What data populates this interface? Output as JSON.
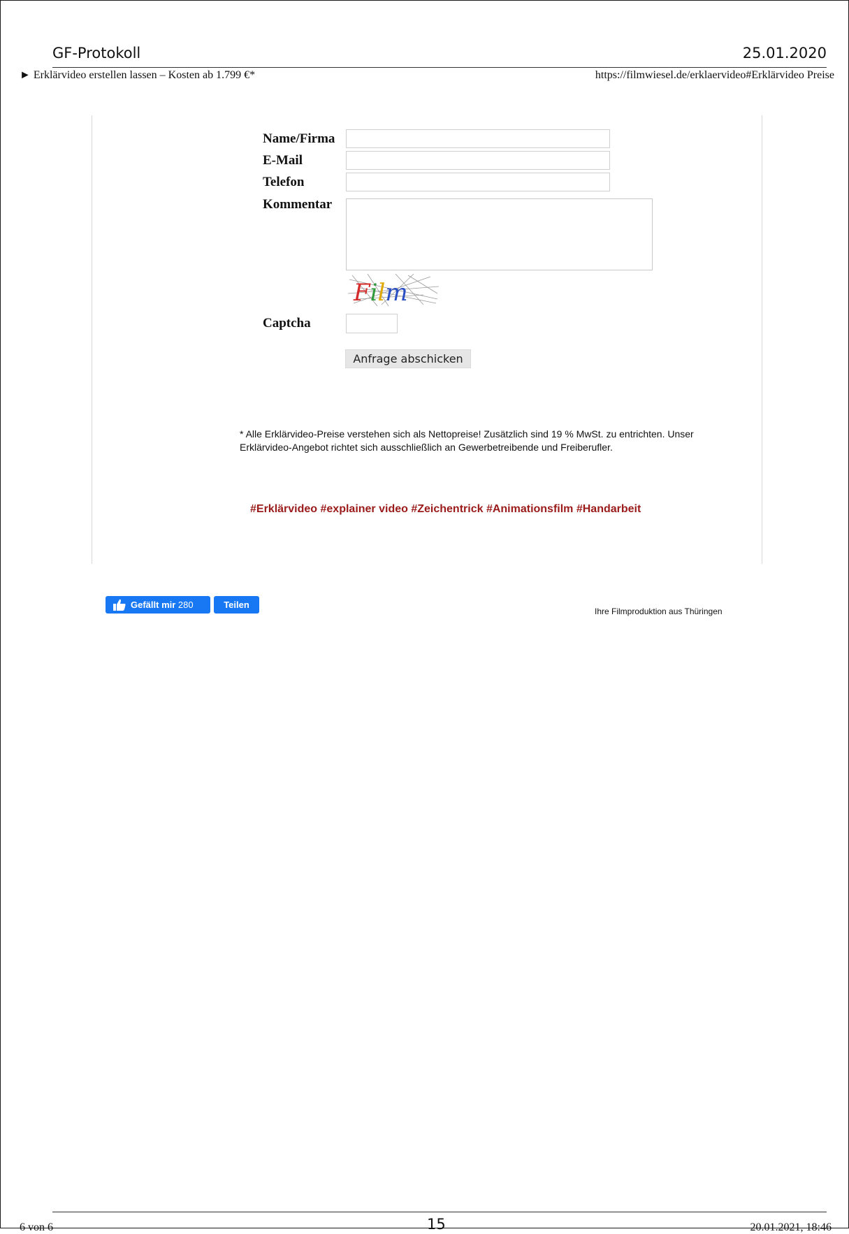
{
  "protocol_header": {
    "title": "GF-Protokoll",
    "date": "25.01.2020"
  },
  "print_header": {
    "page_title": "► Erklärvideo erstellen lassen – Kosten ab 1.799 €*",
    "url": "https://filmwiesel.de/erklaervideo#Erklärvideo Preise"
  },
  "form": {
    "name_label": "Name/Firma",
    "name_value": "",
    "email_label": "E-Mail",
    "email_value": "",
    "phone_label": "Telefon",
    "phone_value": "",
    "comment_label": "Kommentar",
    "comment_value": "",
    "captcha_label": "Captcha",
    "captcha_text": "Film",
    "captcha_value": "",
    "submit_label": "Anfrage abschicken"
  },
  "footnote": "* Alle Erklärvideo-Preise verstehen sich als Nettopreise! Zusätzlich sind 19 % MwSt. zu entrichten. Unser Erklärvideo-Angebot richtet sich ausschließlich an Gewerbetreibende und Freiberufler.",
  "hashtags": "#Erklärvideo #explainer video #Zeichentrick #Animationsfilm #Handarbeit",
  "social": {
    "like_label": "Gefällt mir",
    "like_count": "280",
    "share_label": "Teilen",
    "brand_color": "#1877f2"
  },
  "tagline": "Ihre Filmproduktion aus Thüringen",
  "footer": {
    "page_info": "6 von 6",
    "page_number": "15",
    "printed_at": "20.01.2021, 18:46"
  },
  "colors": {
    "hashtag": "#9b1b1b",
    "button_bg": "#e6e6e6"
  }
}
